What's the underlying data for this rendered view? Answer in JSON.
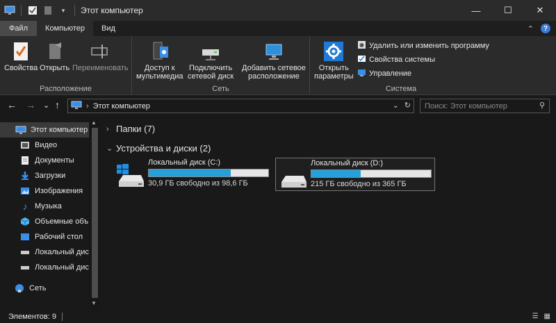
{
  "window": {
    "title": "Этот компьютер",
    "minimize": "—",
    "maximize": "☐",
    "close": "✕"
  },
  "tabs": {
    "file": "Файл",
    "computer": "Компьютер",
    "view": "Вид",
    "collapse": "⌃",
    "help": "?"
  },
  "ribbon": {
    "location": {
      "label": "Расположение",
      "properties": "Свойства",
      "open": "Открыть",
      "rename": "Переименовать"
    },
    "network": {
      "label": "Сеть",
      "media_access_1": "Доступ к",
      "media_access_2": "мультимедиа",
      "map_drive_1": "Подключить",
      "map_drive_2": "сетевой диск",
      "add_location_1": "Добавить сетевое",
      "add_location_2": "расположение"
    },
    "system": {
      "label": "Система",
      "open_settings_1": "Открыть",
      "open_settings_2": "параметры",
      "uninstall": "Удалить или изменить программу",
      "system_props": "Свойства системы",
      "manage": "Управление"
    }
  },
  "nav": {
    "back": "←",
    "forward": "→",
    "recent": "⌄",
    "up": "↑",
    "address_chevron": "›",
    "address_path": "Этот компьютер",
    "address_dropdown": "⌄",
    "refresh": "↻",
    "search_placeholder": "Поиск: Этот компьютер",
    "search_icon": "⚲"
  },
  "sidebar": {
    "items": [
      {
        "label": "Этот компьютер",
        "icon": "computer-icon"
      },
      {
        "label": "Видео",
        "icon": "video-icon"
      },
      {
        "label": "Документы",
        "icon": "documents-icon"
      },
      {
        "label": "Загрузки",
        "icon": "downloads-icon"
      },
      {
        "label": "Изображения",
        "icon": "pictures-icon"
      },
      {
        "label": "Музыка",
        "icon": "music-icon"
      },
      {
        "label": "Объемные объ",
        "icon": "3d-objects-icon"
      },
      {
        "label": "Рабочий стол",
        "icon": "desktop-icon"
      },
      {
        "label": "Локальный дис",
        "icon": "drive-icon"
      },
      {
        "label": "Локальный дис",
        "icon": "drive-icon"
      },
      {
        "label": "Сеть",
        "icon": "network-icon"
      }
    ]
  },
  "content": {
    "folders_header": "Папки (7)",
    "devices_header": "Устройства и диски (2)",
    "drives": [
      {
        "name": "Локальный диск (C:)",
        "free_text": "30,9 ГБ свободно из 98,6 ГБ",
        "used_fraction": 0.687
      },
      {
        "name": "Локальный диск (D:)",
        "free_text": "215 ГБ свободно из 365 ГБ",
        "used_fraction": 0.411
      }
    ]
  },
  "status": {
    "items": "Элементов: 9"
  },
  "colors": {
    "accent": "#26a0da",
    "background": "#191919",
    "ribbon": "#2b2b2b"
  }
}
